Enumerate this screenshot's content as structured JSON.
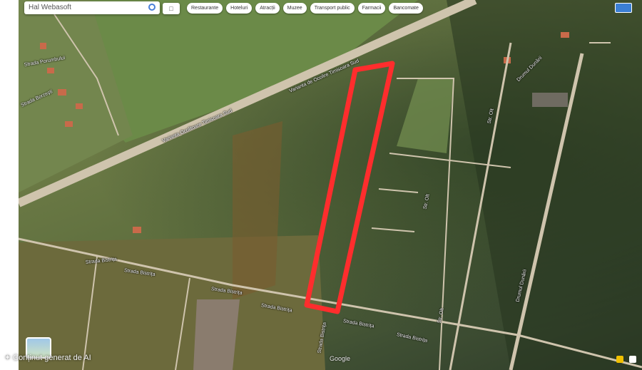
{
  "search": {
    "value": "Hal Webasoft"
  },
  "chips": [
    "Restaurante",
    "Hoteluri",
    "Atracții",
    "Muzee",
    "Transport public",
    "Farmacii",
    "Bancomate"
  ],
  "roads": {
    "bypass_1": "Varianta de Ocolire Timisoara Sud",
    "bypass_2": "Varianta Ocolitoare Timisoara Sud",
    "bistrita_1": "Strada Bistrița",
    "bistrita_2": "Strada Bistrița",
    "bistrita_3": "Strada Bistrița",
    "bistrita_4": "Strada Bistrița",
    "bistrita_5": "Strada Bistrița",
    "bistrita_6": "Strada Bistrița",
    "bistrita_vertical": "Strada Bistrița",
    "olt_1": "Str. Olt",
    "olt_2": "Str. Olt",
    "olt_3": "Str. Olt",
    "dunarea": "Drumul Dunării",
    "dunarea_2": "Drumul Dunării",
    "borzesti": "Strada Borzești",
    "porumbului": "Strada Porumbului"
  },
  "watermark": "Google",
  "ai_caption": "Conținut generat de AI",
  "colors": {
    "highlight": "#ff2d2d",
    "road": "#cfc4ad"
  }
}
